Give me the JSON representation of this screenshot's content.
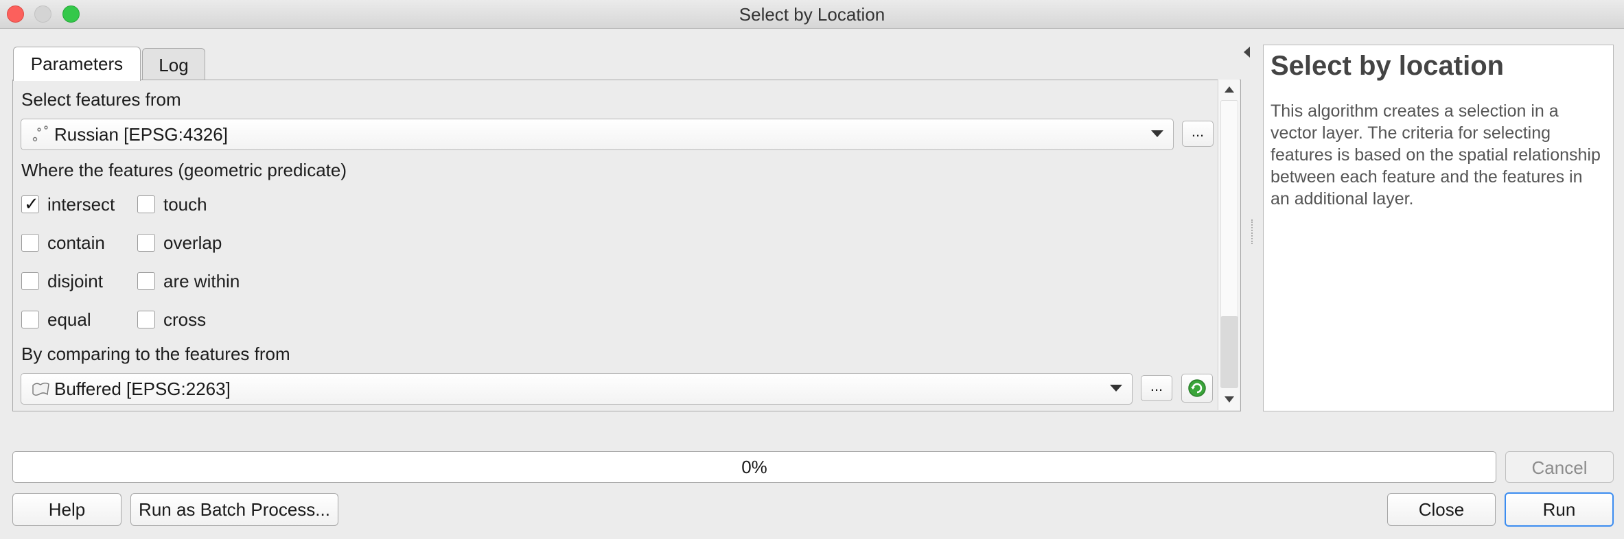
{
  "window": {
    "title": "Select by Location"
  },
  "tabs": [
    {
      "label": "Parameters",
      "active": true
    },
    {
      "label": "Log",
      "active": false
    }
  ],
  "params": {
    "input_label": "Select features from",
    "input_layer": "Russian [EPSG:4326]",
    "input_layer_icon": "point-layer-icon",
    "predicate_label": "Where the features (geometric predicate)",
    "predicates": [
      {
        "label": "intersect",
        "checked": true
      },
      {
        "label": "touch",
        "checked": false
      },
      {
        "label": "contain",
        "checked": false
      },
      {
        "label": "overlap",
        "checked": false
      },
      {
        "label": "disjoint",
        "checked": false
      },
      {
        "label": "are within",
        "checked": false
      },
      {
        "label": "equal",
        "checked": false
      },
      {
        "label": "cross",
        "checked": false
      }
    ],
    "compare_label": "By comparing to the features from",
    "compare_layer": "Buffered [EPSG:2263]",
    "compare_layer_icon": "polygon-layer-icon",
    "browse_label": "..."
  },
  "help": {
    "title": "Select by location",
    "body": "This algorithm creates a selection in a vector layer. The criteria for selecting features is based on the spatial relationship between each feature and the features in an additional layer."
  },
  "progress": {
    "value": 0,
    "text": "0%"
  },
  "buttons": {
    "cancel": "Cancel",
    "help": "Help",
    "batch": "Run as Batch Process...",
    "close": "Close",
    "run": "Run"
  },
  "colors": {
    "accent": "#3b8cf0",
    "close_dot": "#fc605c",
    "max_dot": "#34c84a",
    "refresh_icon": "#3aa53a"
  }
}
